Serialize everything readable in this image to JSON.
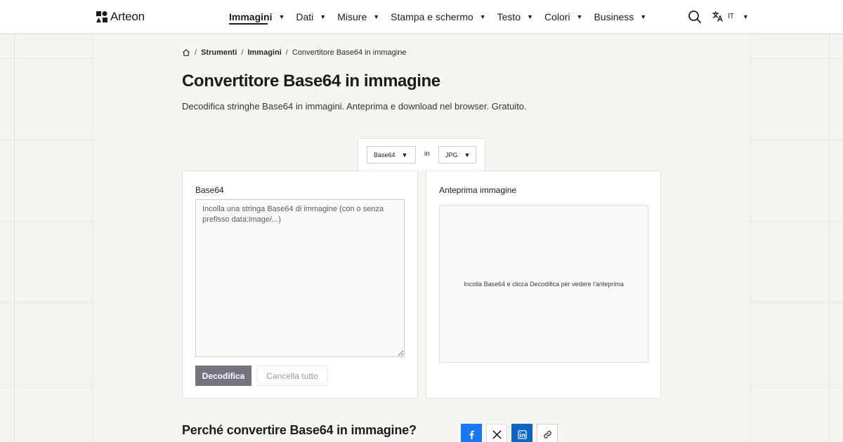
{
  "header": {
    "brand": "Arteon",
    "nav": [
      {
        "label": "Immagini",
        "active": true
      },
      {
        "label": "Dati",
        "active": false
      },
      {
        "label": "Misure",
        "active": false
      },
      {
        "label": "Stampa e schermo",
        "active": false
      },
      {
        "label": "Testo",
        "active": false
      },
      {
        "label": "Colori",
        "active": false
      },
      {
        "label": "Business",
        "active": false
      }
    ],
    "language": "IT",
    "icons": {
      "search": "search-icon",
      "translate": "translate-icon",
      "caret": "caret-down-icon"
    }
  },
  "breadcrumb": {
    "items": [
      "Strumenti",
      "Immagini"
    ],
    "current": "Convertitore Base64 in immagine",
    "separator": "/"
  },
  "page": {
    "title": "Convertitore Base64 in immagine",
    "subtitle": "Decodifica stringhe Base64 in immagini. Anteprima e download nel browser. Gratuito."
  },
  "converter": {
    "from": "Base64",
    "connector": "in",
    "to": "JPG",
    "input": {
      "label": "Base64",
      "placeholder": "Incolla una stringa Base64 di immagine (con o senza prefisso data:image/...)",
      "value": ""
    },
    "decode_label": "Decodifica",
    "clear_label": "Cancella tutto",
    "preview": {
      "label": "Anteprima immagine",
      "empty_text": "Incolla Base64 e clicca Decodifica per vedere l'anteprima"
    }
  },
  "section": {
    "title": "Perché convertire Base64 in immagine?"
  },
  "share": {
    "buttons": [
      "facebook-icon",
      "x-icon",
      "linkedin-icon",
      "link-icon"
    ]
  },
  "colors": {
    "accent_button": "#74747e",
    "facebook": "#1877f2",
    "linkedin": "#0a66c2",
    "background": "#f5f3f0"
  }
}
